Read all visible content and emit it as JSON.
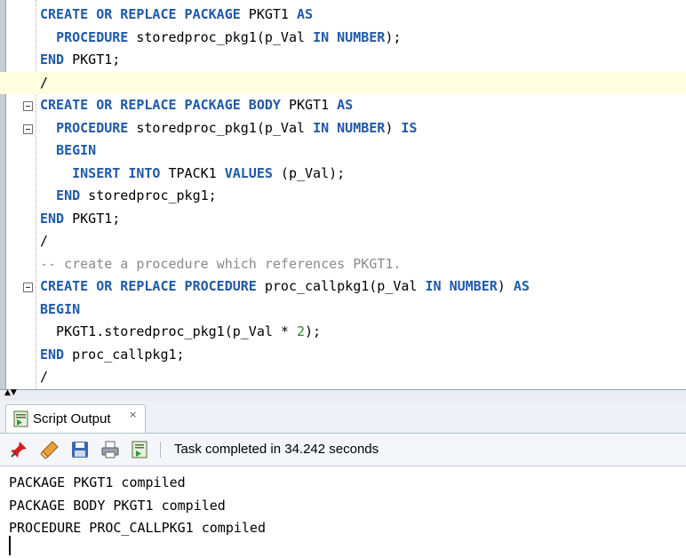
{
  "editor": {
    "lines": [
      [
        {
          "t": "CREATE OR REPLACE PACKAGE",
          "c": "kw"
        },
        {
          "t": " PKGT1 "
        },
        {
          "t": "AS",
          "c": "kw"
        }
      ],
      [
        {
          "t": "  "
        },
        {
          "t": "PROCEDURE",
          "c": "kw"
        },
        {
          "t": " storedproc_pkg1(p_Val "
        },
        {
          "t": "IN NUMBER",
          "c": "kw"
        },
        {
          "t": ");"
        }
      ],
      [
        {
          "t": "END",
          "c": "kw"
        },
        {
          "t": " PKGT1;"
        }
      ],
      [
        {
          "t": "/"
        }
      ],
      [
        {
          "t": "CREATE OR REPLACE PACKAGE BODY",
          "c": "kw"
        },
        {
          "t": " PKGT1 "
        },
        {
          "t": "AS",
          "c": "kw"
        }
      ],
      [
        {
          "t": "  "
        },
        {
          "t": "PROCEDURE",
          "c": "kw"
        },
        {
          "t": " storedproc_pkg1(p_Val "
        },
        {
          "t": "IN NUMBER",
          "c": "kw"
        },
        {
          "t": ") "
        },
        {
          "t": "IS",
          "c": "kw"
        }
      ],
      [
        {
          "t": "  "
        },
        {
          "t": "BEGIN",
          "c": "kw"
        }
      ],
      [
        {
          "t": "    "
        },
        {
          "t": "INSERT INTO",
          "c": "kw"
        },
        {
          "t": " TPACK1 "
        },
        {
          "t": "VALUES",
          "c": "kw"
        },
        {
          "t": " (p_Val);"
        }
      ],
      [
        {
          "t": "  "
        },
        {
          "t": "END",
          "c": "kw"
        },
        {
          "t": " storedproc_pkg1;"
        }
      ],
      [
        {
          "t": "END",
          "c": "kw"
        },
        {
          "t": " PKGT1;"
        }
      ],
      [
        {
          "t": "/"
        }
      ],
      [
        {
          "t": "-- create a procedure which references PKGT1.",
          "c": "cm"
        }
      ],
      [
        {
          "t": "CREATE OR REPLACE PROCEDURE",
          "c": "kw"
        },
        {
          "t": " proc_callpkg1(p_Val "
        },
        {
          "t": "IN NUMBER",
          "c": "kw"
        },
        {
          "t": ") "
        },
        {
          "t": "AS",
          "c": "kw"
        }
      ],
      [
        {
          "t": "BEGIN",
          "c": "kw"
        }
      ],
      [
        {
          "t": "  PKGT1.storedproc_pkg1(p_Val * "
        },
        {
          "t": "2",
          "c": "num"
        },
        {
          "t": ");"
        }
      ],
      [
        {
          "t": "END",
          "c": "kw"
        },
        {
          "t": " proc_callpkg1;"
        }
      ],
      [
        {
          "t": "/"
        }
      ]
    ],
    "fold_lines": [
      4,
      5,
      12
    ],
    "current_line": 3
  },
  "output": {
    "tab_label": "Script Output",
    "tab_close": "×",
    "status": "Task completed in 34.242 seconds",
    "lines": [
      "PACKAGE PKGT1 compiled",
      "PACKAGE BODY PKGT1 compiled",
      "PROCEDURE PROC_CALLPKG1 compiled"
    ]
  },
  "toolbar": {
    "icons": [
      "pin-icon",
      "eraser-icon",
      "save-icon",
      "print-icon",
      "export-icon"
    ]
  },
  "colors": {
    "keyword": "#1f5aa8",
    "comment": "#8a8a8a",
    "number": "#2a8a2a",
    "current_line": "#ffffe0"
  }
}
